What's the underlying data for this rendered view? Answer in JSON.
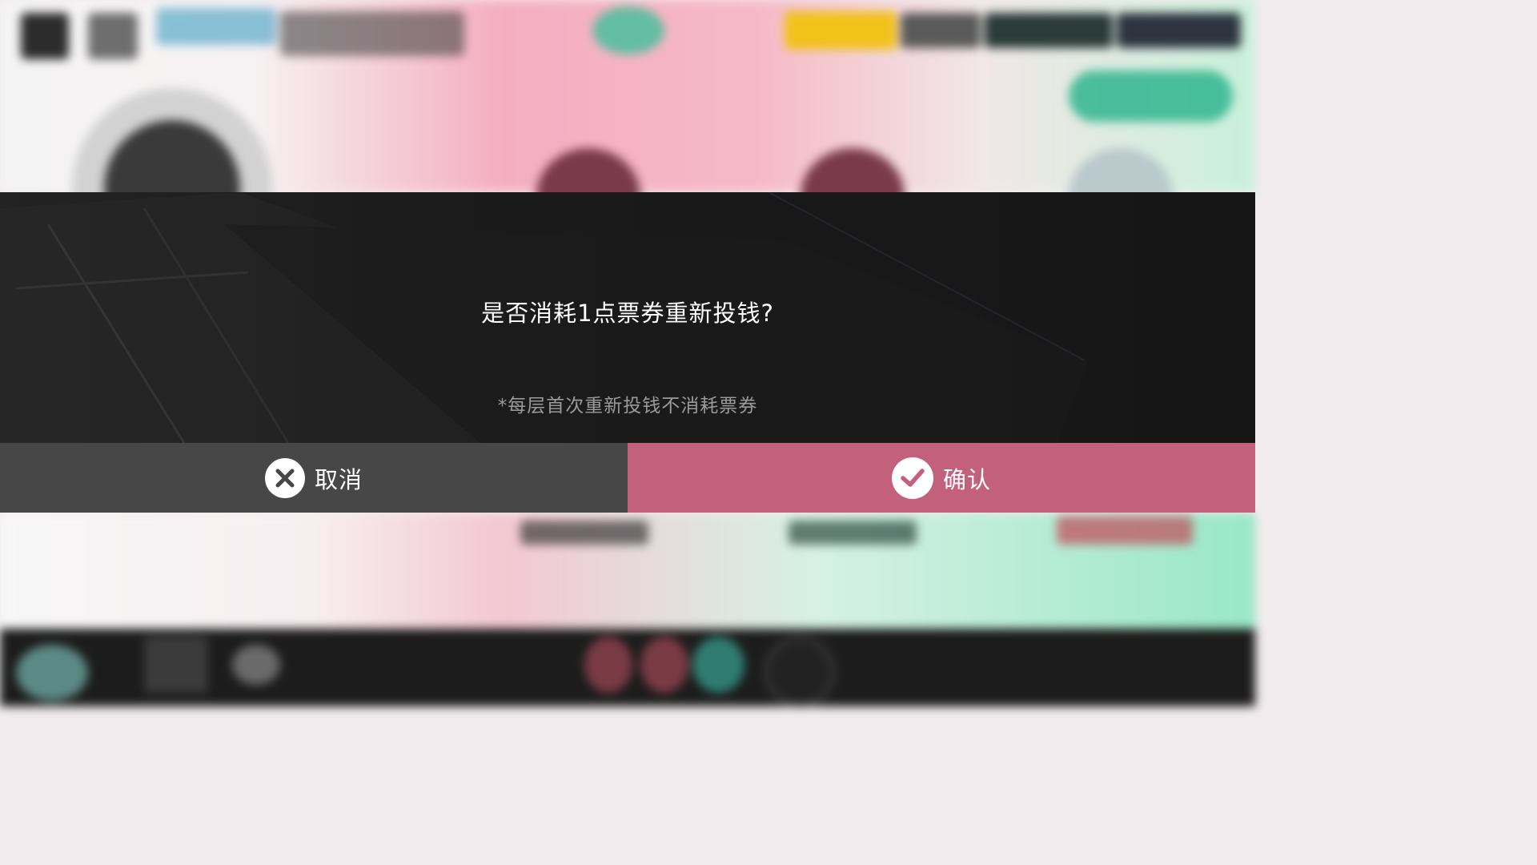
{
  "dialog": {
    "message": "是否消耗1点票券重新投钱?",
    "note": "*每层首次重新投钱不消耗票券"
  },
  "buttons": {
    "cancel_label": "取消",
    "confirm_label": "确认"
  },
  "icons": {
    "cancel": "close-circle-icon",
    "confirm": "check-circle-icon"
  },
  "colors": {
    "dialog_bg": "#1a1a1a",
    "cancel_bg": "#474747",
    "confirm_bg": "#c3617d",
    "note_text": "#9b9b9b"
  }
}
